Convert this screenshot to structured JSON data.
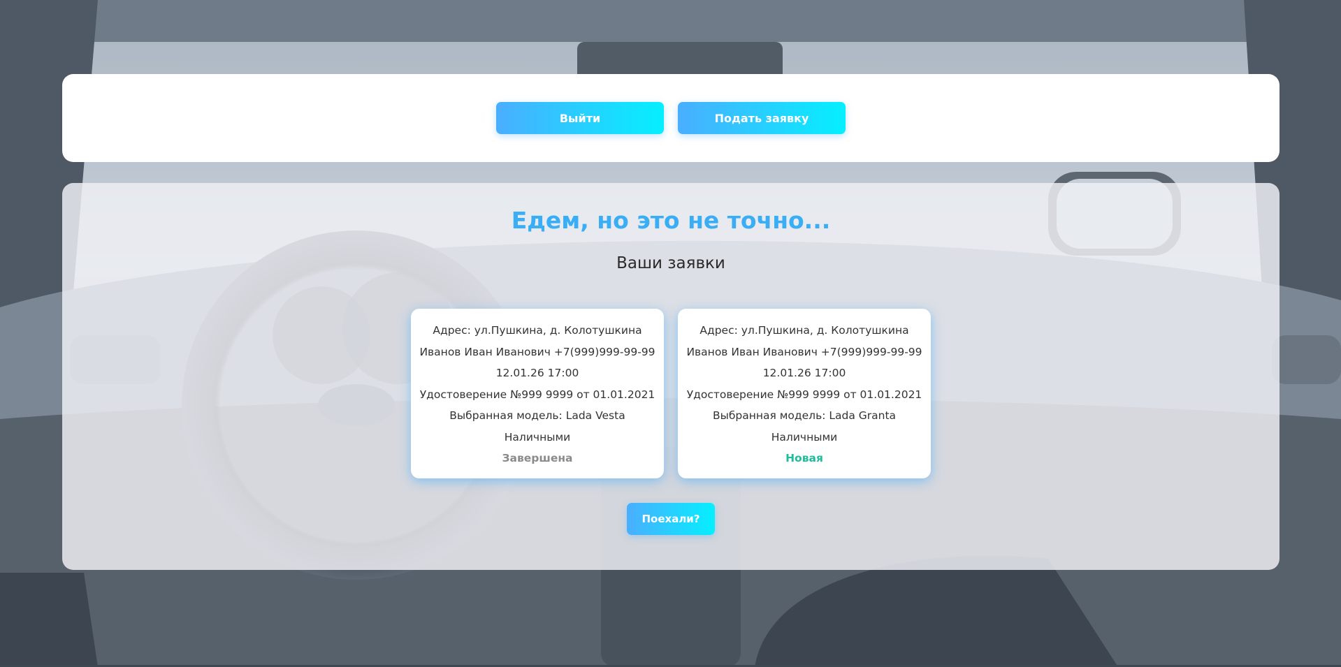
{
  "header": {
    "logout_label": "Выйти",
    "apply_label": "Подать заявку"
  },
  "main": {
    "title": "Едем, но это не точно...",
    "subtitle": "Ваши заявки",
    "go_label": "Поехали?",
    "orders": [
      {
        "address": "Адрес: ул.Пушкина, д. Колотушкина",
        "client": "Иванов Иван Иванович +7(999)999-99-99",
        "datetime": "12.01.26 17:00",
        "license": "Удостоверение №999 9999 от 01.01.2021",
        "model": "Выбранная модель: Lada Vesta",
        "payment": "Наличными",
        "status": "Завершена"
      },
      {
        "address": "Адрес: ул.Пушкина, д. Колотушкина",
        "client": "Иванов Иван Иванович +7(999)999-99-99",
        "datetime": "12.01.26 17:00",
        "license": "Удостоверение №999 9999 от 01.01.2021",
        "model": "Выбранная модель: Lada Granta",
        "payment": "Наличными",
        "status": "Новая"
      }
    ]
  },
  "colors": {
    "accent": "#3aaef5",
    "button_gradient_start": "#4aaeff",
    "button_gradient_end": "#05efff",
    "status_done": "#8b8b8b",
    "status_new": "#1ebd9b"
  },
  "background": {
    "icon": "car-interior-photo"
  }
}
